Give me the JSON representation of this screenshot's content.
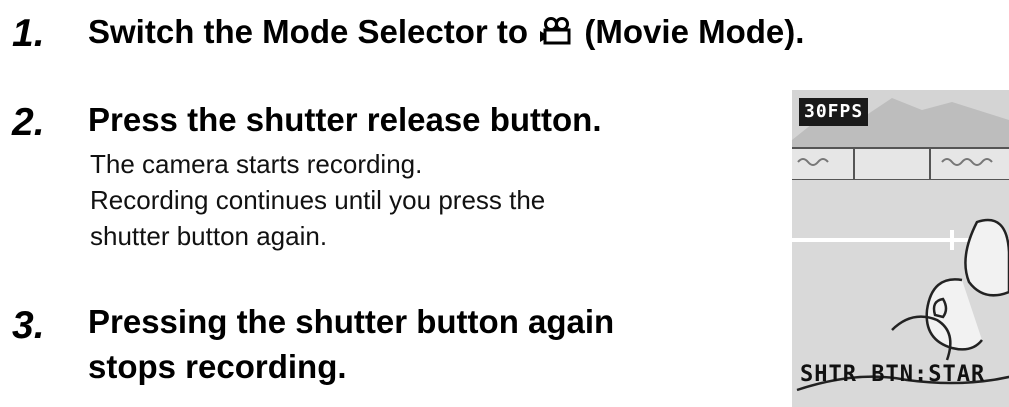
{
  "steps": [
    {
      "number": "1.",
      "heading_before_icon": "Switch the Mode Selector to",
      "icon": "movie-camera-icon",
      "heading_after_icon": "(Movie Mode)."
    },
    {
      "number": "2.",
      "heading": "Press the shutter release button.",
      "body": [
        "The camera starts recording.",
        "Recording continues until you press the",
        "shutter button again."
      ]
    },
    {
      "number": "3.",
      "heading_lines": [
        "Pressing the shutter button again",
        "stops recording."
      ]
    }
  ],
  "lcd_preview": {
    "fps_label": "30FPS",
    "status_text": "SHTR BTN:STAR"
  }
}
